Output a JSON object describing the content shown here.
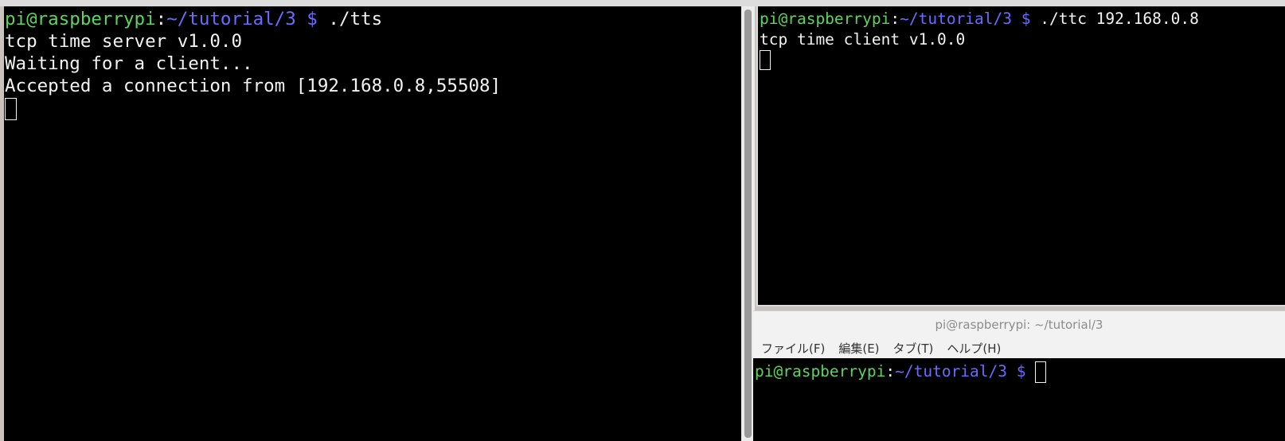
{
  "left_terminal": {
    "prompt_user": "pi@raspberrypi",
    "prompt_sep": ":",
    "prompt_path": "~/tutorial/3",
    "prompt_dollar": " $",
    "command": " ./tts",
    "output": [
      "tcp time server v1.0.0",
      "Waiting for a client...",
      "Accepted a connection from [192.168.0.8,55508]"
    ]
  },
  "right_terminal": {
    "prompt_user": "pi@raspberrypi",
    "prompt_sep": ":",
    "prompt_path": "~/tutorial/3",
    "prompt_dollar": " $",
    "command": " ./ttc 192.168.0.8",
    "output": [
      "tcp time client v1.0.0"
    ]
  },
  "bottom_window": {
    "title": "pi@raspberrypi: ~/tutorial/3",
    "menu": [
      "ファイル(F)",
      "編集(E)",
      "タブ(T)",
      "ヘルプ(H)"
    ],
    "prompt_user": "pi@raspberrypi",
    "prompt_sep": ":",
    "prompt_path": "~/tutorial/3",
    "prompt_dollar": " $ "
  },
  "colors": {
    "prompt_user": "#5ed45e",
    "prompt_path": "#6b6bff",
    "terminal_bg": "#000000",
    "terminal_fg": "#f2f2f2"
  }
}
